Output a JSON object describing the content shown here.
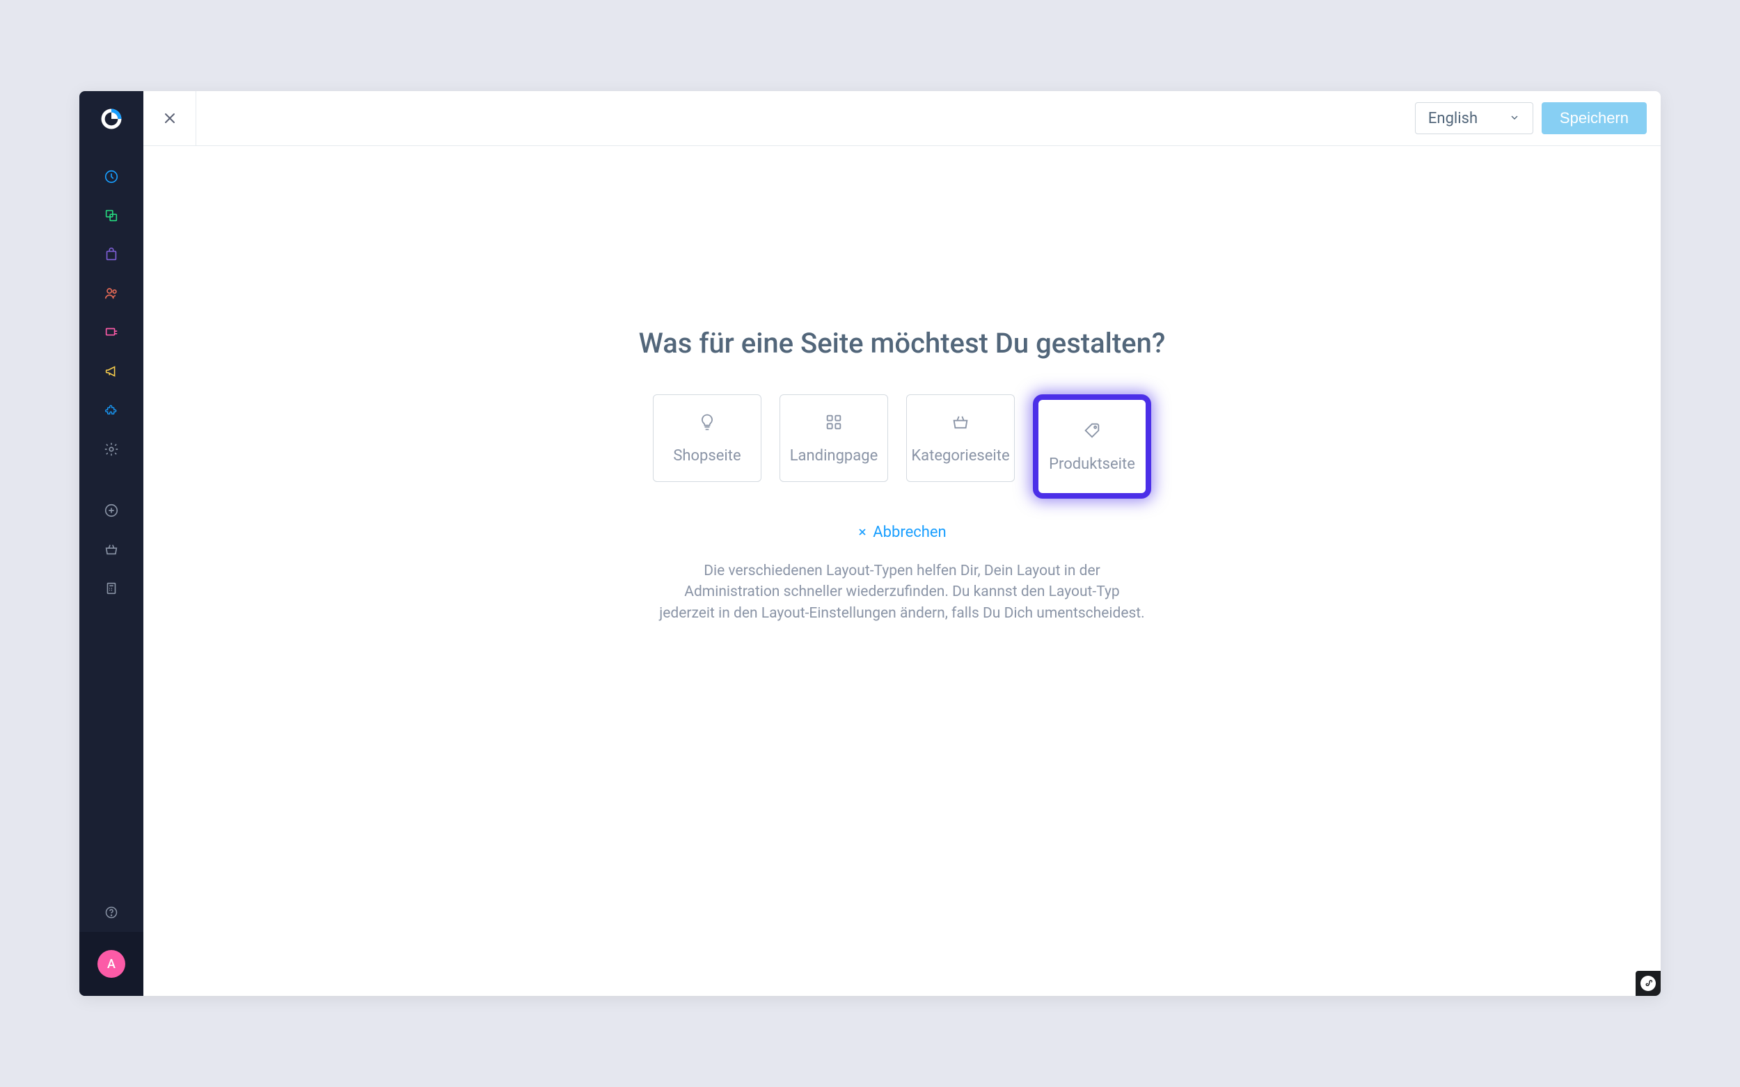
{
  "topbar": {
    "language": "English",
    "save_label": "Speichern"
  },
  "content": {
    "heading": "Was für eine Seite möchtest Du gestalten?",
    "options": [
      {
        "label": "Shopseite"
      },
      {
        "label": "Landingpage"
      },
      {
        "label": "Kategorieseite"
      },
      {
        "label": "Produktseite"
      }
    ],
    "cancel_label": "Abbrechen",
    "helper_text": "Die verschiedenen Layout-Typen helfen Dir, Dein Layout in der Administration schneller wiederzufinden. Du kannst den Layout-Typ jederzeit in den Layout-Einstellungen ändern, falls Du Dich umentscheidest."
  },
  "sidebar": {
    "avatar_letter": "A"
  },
  "colors": {
    "sidebar_bg": "#1a2033",
    "avatar_bg": "#fc5ba7",
    "accent_blue": "#189eff",
    "highlight_purple": "#4b2fe8",
    "save_btn_bg": "#87cff3"
  }
}
